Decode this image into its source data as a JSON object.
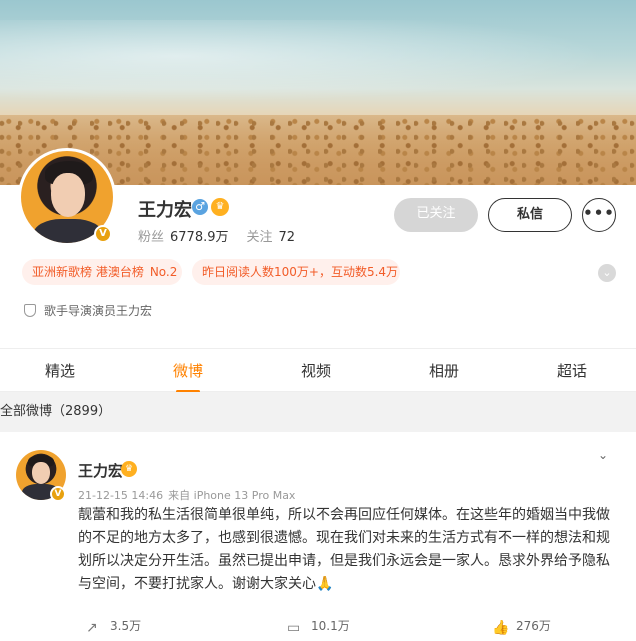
{
  "profile": {
    "name": "王力宏",
    "fans_label": "粉丝",
    "fans_count": "6778.9万",
    "follow_label": "关注",
    "follow_count": "72",
    "gender_icon": "male-icon",
    "verified_badge": "V"
  },
  "actions": {
    "followed_label": "已关注",
    "message_label": "私信",
    "more_label": "•••"
  },
  "tags": [
    {
      "text": "亚洲新歌榜 港澳台榜",
      "rank": "No.2"
    },
    {
      "text": "昨日阅读人数100万+，互动数5.4万"
    }
  ],
  "bio": "歌手导演演员王力宏",
  "tabs": [
    {
      "label": "精选"
    },
    {
      "label": "微博"
    },
    {
      "label": "视频"
    },
    {
      "label": "相册"
    },
    {
      "label": "超话"
    }
  ],
  "active_tab": "微博",
  "section": {
    "title": "全部微博（2899）"
  },
  "post": {
    "author": "王力宏",
    "time": "21-12-15 14:46",
    "source": "来自 iPhone 13 Pro Max",
    "text": "靓蕾和我的私生活很简单很单纯，所以不会再回应任何媒体。在这些年的婚姻当中我做的不足的地方太多了，也感到很遗憾。现在我们对未来的生活方式有不一样的想法和规划所以决定分开生活。虽然已提出申请，但是我们永远会是一家人。恳求外界给予隐私与空间，不要打扰家人。谢谢大家关心🙏",
    "reposts": "3.5万",
    "comments": "10.1万",
    "likes": "276万"
  },
  "colors": {
    "accent": "#ff8200",
    "tag_text": "#f25c28",
    "tag_bg": "#fff0ec",
    "followed_btn": "#d6d6d6"
  }
}
